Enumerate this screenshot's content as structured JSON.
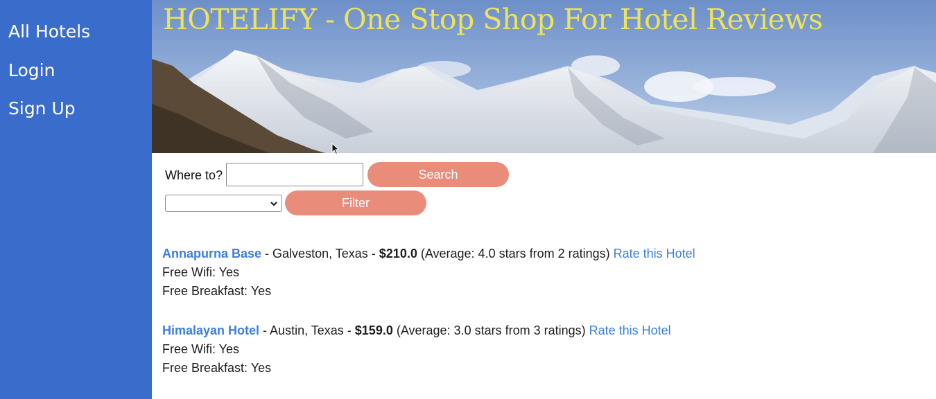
{
  "sidebar": {
    "items": [
      {
        "label": "All Hotels"
      },
      {
        "label": "Login"
      },
      {
        "label": "Sign Up"
      }
    ]
  },
  "banner": {
    "title": "HOTELIFY - One Stop Shop For Hotel Reviews"
  },
  "search": {
    "label": "Where to?",
    "value": "",
    "button_label": "Search"
  },
  "filter": {
    "selected": "",
    "button_label": "Filter"
  },
  "hotels": [
    {
      "name": "Annapurna Base",
      "location_sep": " - Galveston, Texas - ",
      "price": "$210.0",
      "rating_text": " (Average: 4.0 stars from 2 ratings) ",
      "rate_link": "Rate this Hotel",
      "wifi": "Free Wifi: Yes",
      "breakfast": "Free Breakfast: Yes"
    },
    {
      "name": "Himalayan Hotel",
      "location_sep": " - Austin, Texas - ",
      "price": "$159.0",
      "rating_text": " (Average: 3.0 stars from 3 ratings) ",
      "rate_link": "Rate this Hotel",
      "wifi": "Free Wifi: Yes",
      "breakfast": "Free Breakfast: Yes"
    }
  ],
  "colors": {
    "sidebar": "#3a6ccb",
    "button": "#ea8c7a",
    "link": "#3c7de0",
    "title": "#ede35a"
  },
  "icons": {
    "banner_image": "mountain-range-image",
    "cursor": "mouse-cursor-icon"
  }
}
